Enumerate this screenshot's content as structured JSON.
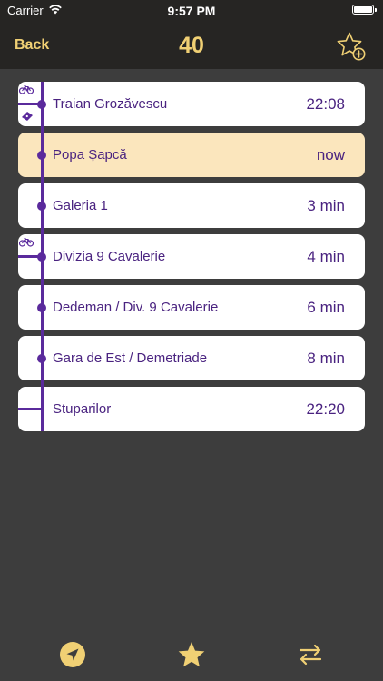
{
  "status_bar": {
    "carrier": "Carrier",
    "time": "9:57 PM",
    "wifi_icon": "wifi-icon",
    "battery_icon": "battery-icon"
  },
  "nav": {
    "back_label": "Back",
    "title": "40",
    "favorite_icon": "star-add-icon"
  },
  "colors": {
    "accent": "#f0d074",
    "route": "#5a2a9c",
    "text": "#4a2380",
    "current_bg": "#fbe6bd",
    "background": "#3d3d3d",
    "header": "#262523"
  },
  "stops": [
    {
      "name": "Traian Grozăvescu",
      "eta": "22:08",
      "icons": [
        "bike-icon",
        "ticket-icon"
      ]
    },
    {
      "name": "Popa Șapcă",
      "eta": "now",
      "current": true
    },
    {
      "name": "Galeria 1",
      "eta": "3 min"
    },
    {
      "name": "Divizia 9 Cavalerie",
      "eta": "4 min",
      "icons": [
        "bike-icon"
      ]
    },
    {
      "name": "Dedeman / Div. 9 Cavalerie",
      "eta": "6 min"
    },
    {
      "name": "Gara de Est / Demetriade",
      "eta": "8 min"
    },
    {
      "name": "Stuparilor",
      "eta": "22:20"
    }
  ],
  "tabbar": {
    "items": [
      "location-arrow-icon",
      "star-icon",
      "swap-direction-icon"
    ]
  }
}
